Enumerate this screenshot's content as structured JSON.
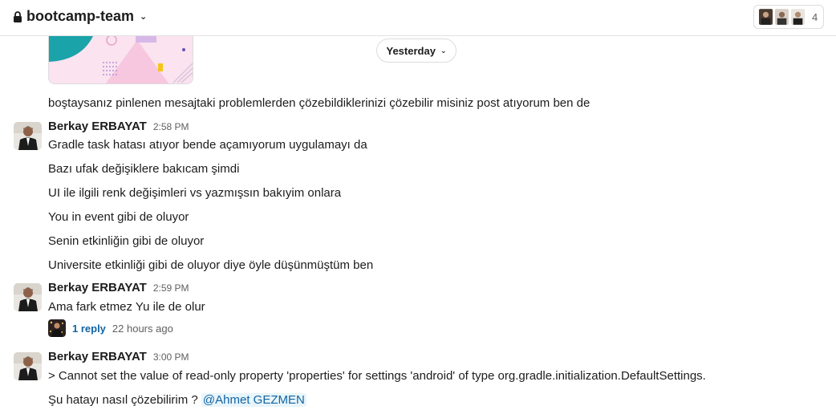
{
  "header": {
    "channel_name": "bootcamp-team",
    "member_count": "4"
  },
  "divider": {
    "date_label": "Yesterday"
  },
  "prev_message": {
    "text": "boştaysanız pinlenen mesajtaki problemlerden çözebildiklerinizi çözebilir misiniz post atıyorum ben de"
  },
  "messages": [
    {
      "author": "Berkay ERBAYAT",
      "time": "2:58 PM",
      "lines": [
        "Gradle task hatası atıyor bende açamıyorum uygulamayı da",
        "Bazı ufak değişiklere bakıcam şimdi",
        "UI ile ilgili renk değişimleri vs yazmışsın bakıyim onlara",
        "You in event gibi de oluyor",
        "Senin etkinliğin gibi de oluyor",
        "Universite etkinliği gibi de oluyor diye öyle düşünmüştüm ben"
      ]
    },
    {
      "author": "Berkay ERBAYAT",
      "time": "2:59 PM",
      "lines": [
        "Ama fark etmez Yu ile de olur"
      ],
      "thread": {
        "replies": "1 reply",
        "last_reply": "22 hours ago"
      }
    },
    {
      "author": "Berkay ERBAYAT",
      "time": "3:00 PM",
      "lines": [
        "> Cannot set the value of read-only property 'properties' for settings 'android' of type org.gradle.initialization.DefaultSettings.",
        "Şu hatayı nasıl çözebilirim ? "
      ],
      "mention": "@Ahmet GEZMEN"
    }
  ]
}
